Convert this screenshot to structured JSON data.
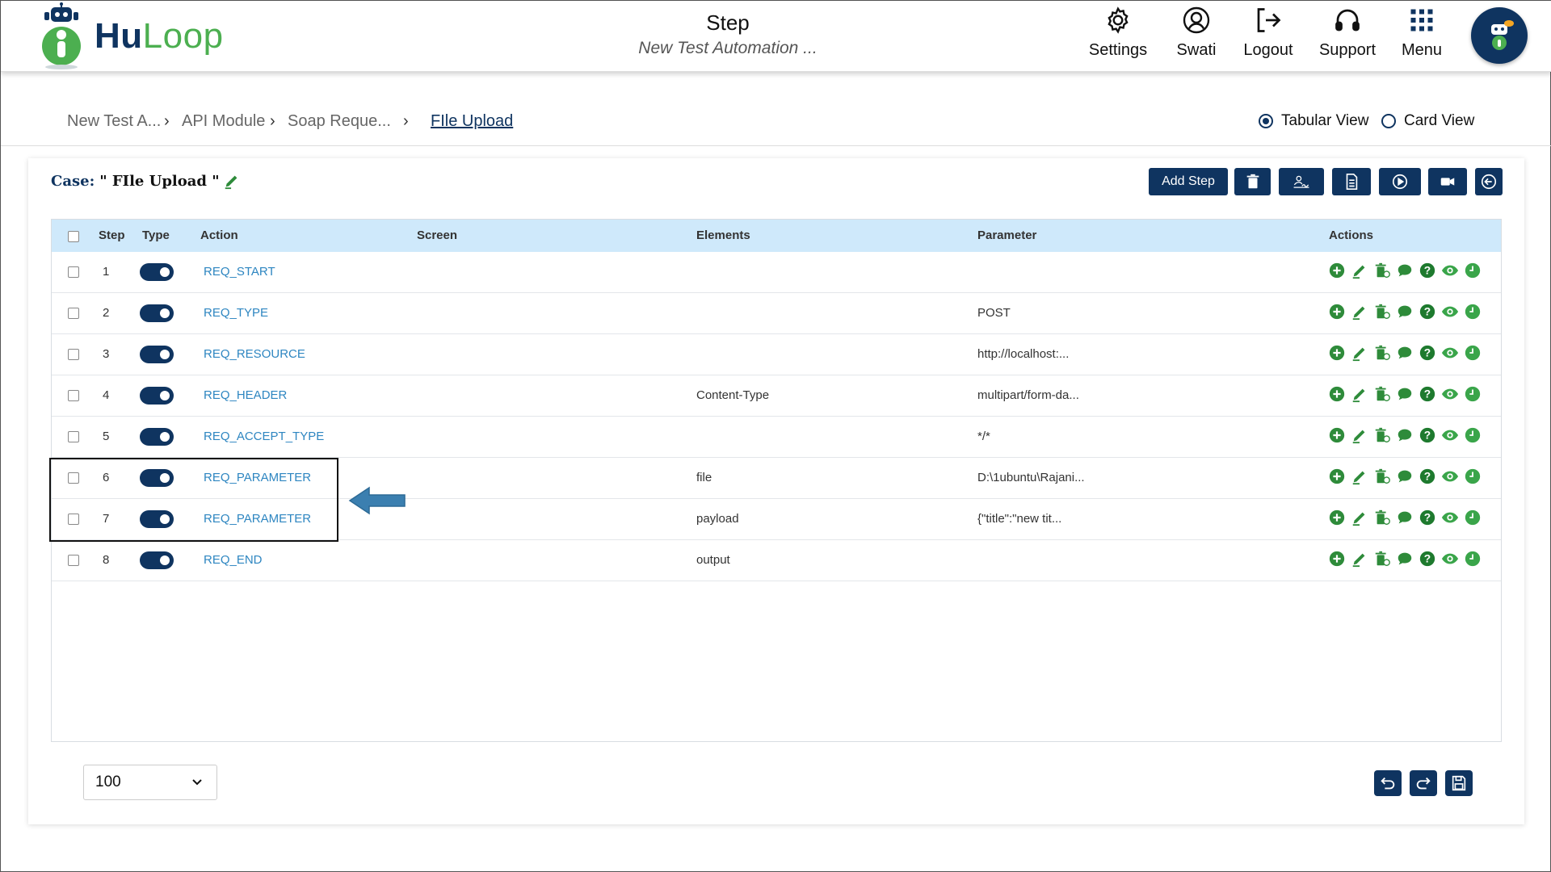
{
  "header": {
    "brand_hu": "Hu",
    "brand_loop": "Loop",
    "title": "Step",
    "subtitle": "New Test Automation ...",
    "nav": [
      {
        "label": "Settings",
        "icon": "gear-icon"
      },
      {
        "label": "Swati",
        "icon": "user-icon"
      },
      {
        "label": "Logout",
        "icon": "logout-icon"
      },
      {
        "label": "Support",
        "icon": "headset-icon"
      },
      {
        "label": "Menu",
        "icon": "grid-icon"
      }
    ]
  },
  "breadcrumb": {
    "items": [
      "New Test A...",
      "API Module",
      "Soap Reque...",
      "FIle Upload"
    ]
  },
  "views": {
    "tabular": "Tabular View",
    "card": "Card View",
    "selected": "Tabular View"
  },
  "case": {
    "prefix": "Case:",
    "name": "\" FIle Upload \""
  },
  "toolbar": {
    "add_step": "Add Step"
  },
  "table": {
    "headers": {
      "step": "Step",
      "type": "Type",
      "action": "Action",
      "screen": "Screen",
      "elements": "Elements",
      "parameter": "Parameter",
      "actions": "Actions"
    },
    "rows": [
      {
        "step": "1",
        "action": "REQ_START",
        "screen": "",
        "elements": "",
        "parameter": ""
      },
      {
        "step": "2",
        "action": "REQ_TYPE",
        "screen": "",
        "elements": "",
        "parameter": "POST"
      },
      {
        "step": "3",
        "action": "REQ_RESOURCE",
        "screen": "",
        "elements": "",
        "parameter": "http://localhost:..."
      },
      {
        "step": "4",
        "action": "REQ_HEADER",
        "screen": "",
        "elements": "Content-Type",
        "parameter": "multipart/form-da..."
      },
      {
        "step": "5",
        "action": "REQ_ACCEPT_TYPE",
        "screen": "",
        "elements": "",
        "parameter": "*/*"
      },
      {
        "step": "6",
        "action": "REQ_PARAMETER",
        "screen": "",
        "elements": "file",
        "parameter": "D:\\1ubuntu\\Rajani..."
      },
      {
        "step": "7",
        "action": "REQ_PARAMETER",
        "screen": "",
        "elements": "payload",
        "parameter": "{\"title\":\"new tit..."
      },
      {
        "step": "8",
        "action": "REQ_END",
        "screen": "",
        "elements": "output",
        "parameter": ""
      }
    ]
  },
  "pagination": {
    "page_size": "100"
  },
  "colors": {
    "primary": "#0f3460",
    "accent_green": "#2e8b3a",
    "header_row": "#cfe9fb",
    "link": "#2e86c1"
  }
}
